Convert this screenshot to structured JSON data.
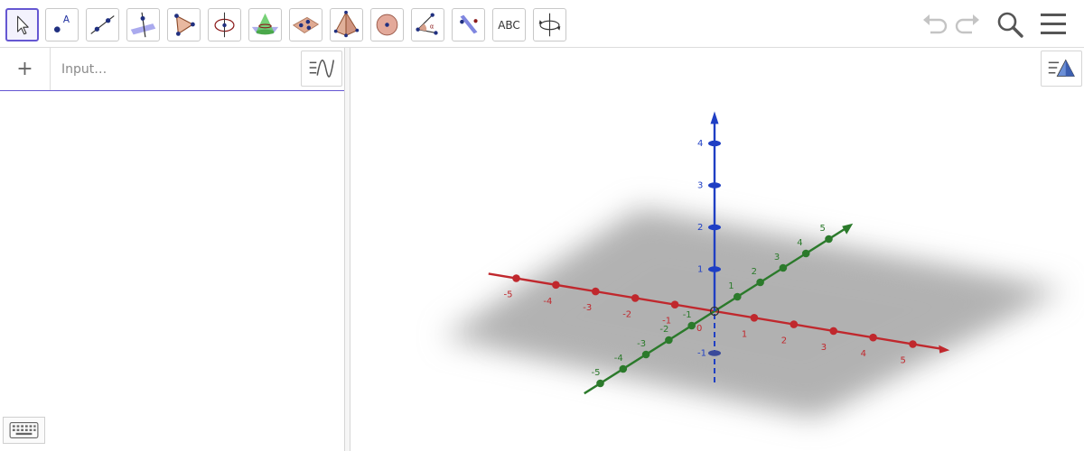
{
  "toolbar": {
    "tools": [
      {
        "name": "move-tool",
        "icon": "arrow-cursor-icon",
        "selected": true
      },
      {
        "name": "point-tool",
        "icon": "point-a-icon"
      },
      {
        "name": "line-tool",
        "icon": "line-through-points-icon"
      },
      {
        "name": "perpendicular-line-tool",
        "icon": "perpendicular-line-icon"
      },
      {
        "name": "polygon-tool",
        "icon": "polygon-icon"
      },
      {
        "name": "circle-axis-tool",
        "icon": "circle-with-axis-icon"
      },
      {
        "name": "intersect-surfaces-tool",
        "icon": "intersect-cone-plane-icon"
      },
      {
        "name": "plane-three-points-tool",
        "icon": "plane-three-points-icon"
      },
      {
        "name": "pyramid-tool",
        "icon": "pyramid-icon"
      },
      {
        "name": "sphere-tool",
        "icon": "sphere-icon"
      },
      {
        "name": "angle-tool",
        "icon": "angle-icon"
      },
      {
        "name": "reflect-plane-tool",
        "icon": "reflect-about-plane-icon"
      },
      {
        "name": "text-tool",
        "icon": "text-abc-icon",
        "label": "ABC"
      },
      {
        "name": "rotate-view-tool",
        "icon": "rotate-view-icon"
      }
    ],
    "right": [
      "undo-icon",
      "redo-icon",
      "search-icon",
      "menu-icon"
    ]
  },
  "algebra": {
    "add_symbol": "+",
    "input_placeholder": "Input…"
  },
  "axes": {
    "x": {
      "color": "#c0282d",
      "labels": [
        "-5",
        "-4",
        "-3",
        "-2",
        "-1",
        "0",
        "1",
        "2",
        "3",
        "4",
        "5"
      ]
    },
    "y": {
      "color": "#2b7a2b",
      "labels": [
        "-5",
        "-4",
        "-3",
        "-2",
        "-1",
        "0",
        "1",
        "2",
        "3",
        "4",
        "5"
      ]
    },
    "z": {
      "color": "#1f3fc4",
      "labels": [
        "-1",
        "1",
        "2",
        "3",
        "4"
      ]
    }
  },
  "colors": {
    "accent": "#6557d2",
    "plane": "#b4b4b4"
  }
}
